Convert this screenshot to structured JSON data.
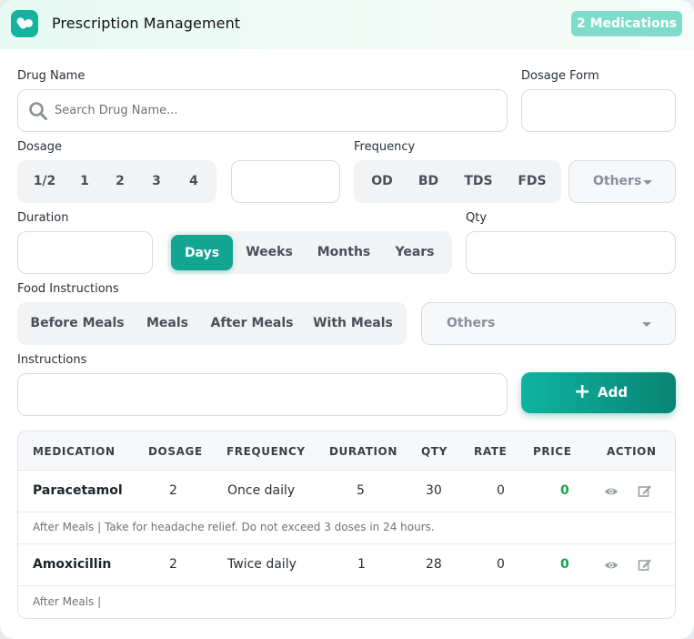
{
  "header": {
    "title": "Prescription Management",
    "badge": "2 Medications"
  },
  "form": {
    "drug_name": {
      "label": "Drug Name",
      "placeholder": "Search Drug Name..."
    },
    "dosage_form": {
      "label": "Dosage Form",
      "value": ""
    },
    "dosage": {
      "label": "Dosage",
      "options": [
        "1/2",
        "1",
        "2",
        "3",
        "4"
      ],
      "value": ""
    },
    "frequency": {
      "label": "Frequency",
      "options": [
        "OD",
        "BD",
        "TDS",
        "FDS"
      ],
      "others": "Others"
    },
    "duration": {
      "label": "Duration",
      "value": "",
      "units": [
        "Days",
        "Weeks",
        "Months",
        "Years"
      ],
      "selected": "Days"
    },
    "qty": {
      "label": "Qty",
      "value": ""
    },
    "food": {
      "label": "Food Instructions",
      "options": [
        "Before Meals",
        "Meals",
        "After Meals",
        "With Meals"
      ],
      "others": "Others"
    },
    "instructions": {
      "label": "Instructions",
      "value": ""
    },
    "add_label": "Add"
  },
  "table": {
    "columns": [
      "MEDICATION",
      "DOSAGE",
      "FREQUENCY",
      "DURATION",
      "QTY",
      "RATE",
      "PRICE",
      "ACTION"
    ],
    "rows": [
      {
        "medication": "Paracetamol",
        "dosage": "2",
        "frequency": "Once daily",
        "duration": "5",
        "qty": "30",
        "rate": "0",
        "price": "0",
        "note": "After Meals | Take for headache relief. Do not exceed 3 doses in 24 hours."
      },
      {
        "medication": "Amoxicillin",
        "dosage": "2",
        "frequency": "Twice daily",
        "duration": "1",
        "qty": "28",
        "rate": "0",
        "price": "0",
        "note": "After Meals |"
      }
    ]
  },
  "colors": {
    "accent": "#11a592",
    "badge": "#7ddcca",
    "price": "#17a34a"
  },
  "icons": [
    "pills-icon",
    "search-icon",
    "chevron-down-icon",
    "plus-icon",
    "eye-icon",
    "edit-icon"
  ]
}
